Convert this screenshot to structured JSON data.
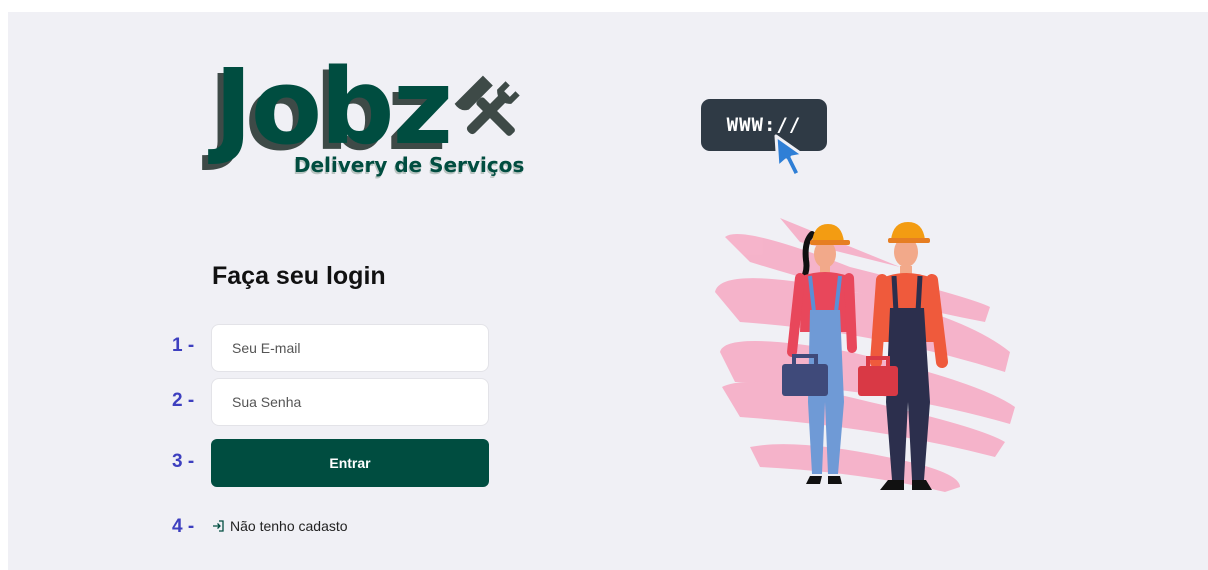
{
  "logo": {
    "brand": "Jobz",
    "tagline": "Delivery de Serviços"
  },
  "badge": {
    "text": "WWW://"
  },
  "login": {
    "title": "Faça seu login",
    "email_placeholder": "Seu E-mail",
    "password_placeholder": "Sua Senha",
    "submit_label": "Entrar",
    "register_label": "Não tenho cadasto"
  },
  "steps": [
    "1 -",
    "2 -",
    "3 -",
    "4 -"
  ],
  "colors": {
    "brand": "#004d40",
    "step_labels": "#3d3fbf",
    "background": "#f0f0f5",
    "badge": "#2f3a45",
    "accent_pink": "#f6b0c8"
  },
  "icons": [
    "hammer-wrench-icon",
    "cursor-arrow-icon",
    "sign-in-icon"
  ]
}
